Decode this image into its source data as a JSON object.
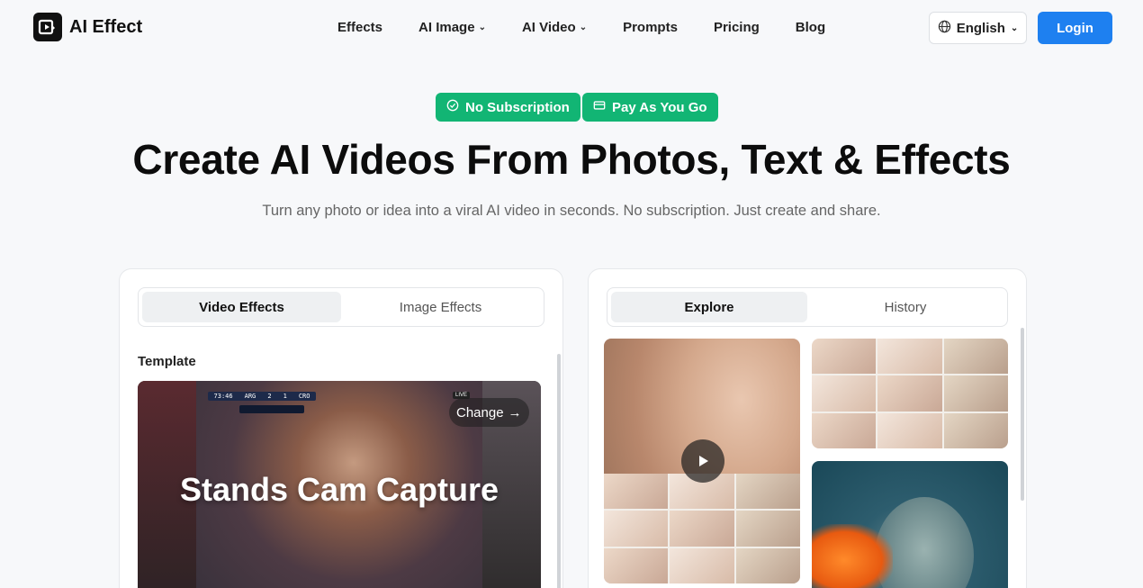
{
  "header": {
    "logo_text": "AI Effect",
    "nav": [
      {
        "label": "Effects",
        "has_dropdown": false
      },
      {
        "label": "AI Image",
        "has_dropdown": true
      },
      {
        "label": "AI Video",
        "has_dropdown": true
      },
      {
        "label": "Prompts",
        "has_dropdown": false
      },
      {
        "label": "Pricing",
        "has_dropdown": false
      },
      {
        "label": "Blog",
        "has_dropdown": false
      }
    ],
    "language": "English",
    "login_label": "Login"
  },
  "hero": {
    "badges": [
      {
        "label": "No Subscription",
        "icon": "check-circle-icon"
      },
      {
        "label": "Pay As You Go",
        "icon": "credit-card-icon"
      }
    ],
    "title": "Create AI Videos From Photos, Text & Effects",
    "subtitle": "Turn any photo or idea into a viral AI video in seconds. No subscription. Just create and share."
  },
  "left_panel": {
    "tabs": [
      {
        "label": "Video Effects",
        "active": true
      },
      {
        "label": "Image Effects",
        "active": false
      }
    ],
    "template_label": "Template",
    "template": {
      "title": "Stands Cam Capture",
      "change_label": "Change",
      "scoreboard": {
        "time": "73:46",
        "home": "ARG",
        "home_score": "2",
        "away_score": "1",
        "away": "CRO"
      },
      "live_label": "LIVE"
    }
  },
  "right_panel": {
    "tabs": [
      {
        "label": "Explore",
        "active": true
      },
      {
        "label": "History",
        "active": false
      }
    ]
  },
  "colors": {
    "accent_blue": "#1e80f0",
    "badge_green": "#12b574",
    "background": "#f7f8fa"
  }
}
